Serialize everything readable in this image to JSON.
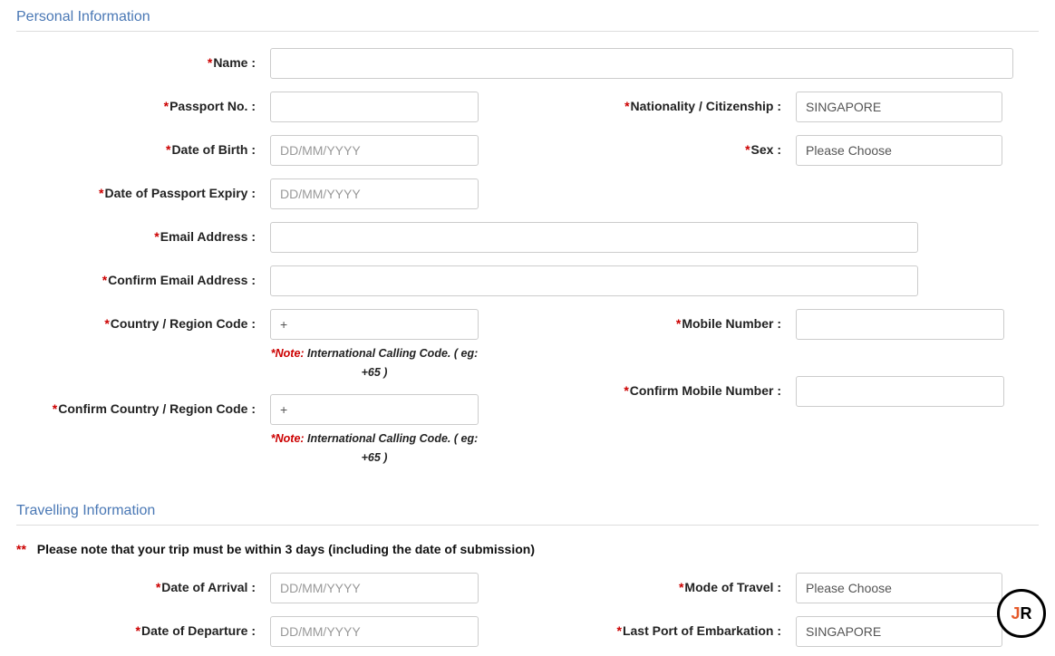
{
  "sections": {
    "personal": {
      "title": "Personal Information"
    },
    "travel": {
      "title": "Travelling Information"
    }
  },
  "labels": {
    "name": "Name :",
    "passport_no": "Passport No. :",
    "nationality": "Nationality / Citizenship :",
    "dob": "Date of Birth :",
    "sex": "Sex :",
    "passport_expiry": "Date of Passport Expiry :",
    "email": "Email Address :",
    "confirm_email": "Confirm Email Address :",
    "country_code": "Country / Region Code :",
    "mobile": "Mobile Number :",
    "confirm_country_code": "Confirm Country / Region Code :",
    "confirm_mobile": "Confirm Mobile Number :",
    "arrival": "Date of Arrival :",
    "departure": "Date of Departure :",
    "mode_travel": "Mode of Travel :",
    "last_port": "Last Port of Embarkation :"
  },
  "values": {
    "nationality": "SINGAPORE",
    "sex": "Please Choose",
    "country_code": "+",
    "confirm_country_code": "+",
    "mode_travel": "Please Choose",
    "last_port": "SINGAPORE"
  },
  "placeholders": {
    "date": "DD/MM/YYYY"
  },
  "notes": {
    "note_label": "*Note:",
    "calling_code": " International Calling Code.  ( eg: +65 )"
  },
  "warnings": {
    "trip_days": "Please note that your trip must be within 3 days (including the date of submission)"
  },
  "required_mark": "*",
  "double_star": "**"
}
